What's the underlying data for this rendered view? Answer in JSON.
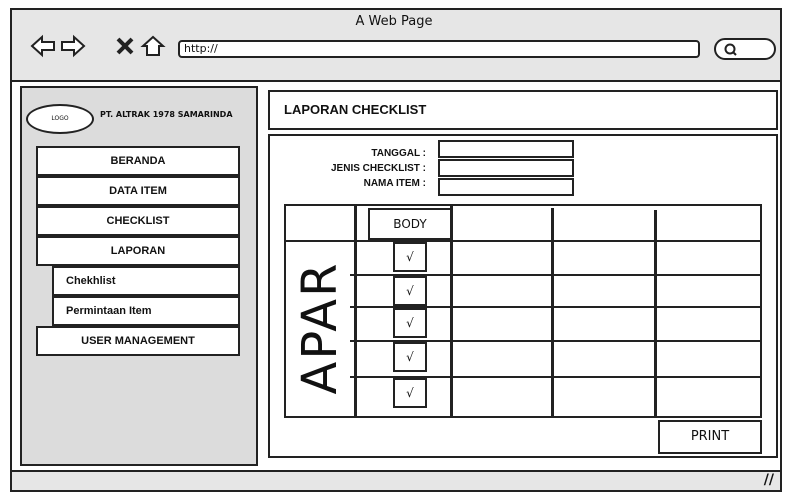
{
  "window": {
    "title": "A Web Page",
    "url": "http://"
  },
  "icons": [
    "back-arrow-icon",
    "forward-arrow-icon",
    "close-icon",
    "home-icon",
    "search-icon"
  ],
  "sidebar": {
    "logo_text": "LOGO",
    "company": "PT. ALTRAK 1978 SAMARINDA",
    "items": [
      {
        "label": "BERANDA"
      },
      {
        "label": "DATA ITEM"
      },
      {
        "label": "CHECKLIST"
      },
      {
        "label": "LAPORAN"
      },
      {
        "label": "Chekhlist"
      },
      {
        "label": "Permintaan Item"
      },
      {
        "label": "USER MANAGEMENT"
      }
    ]
  },
  "main": {
    "header": "LAPORAN CHECKLIST",
    "fields": [
      {
        "label": "TANGGAL :",
        "value": ""
      },
      {
        "label": "JENIS CHECKLIST :",
        "value": ""
      },
      {
        "label": "NAMA ITEM :",
        "value": ""
      }
    ],
    "table": {
      "column_header": "BODY",
      "row_label": "APAR",
      "checks": [
        "√",
        "√",
        "√",
        "√",
        "√"
      ]
    },
    "print_label": "PRINT"
  }
}
